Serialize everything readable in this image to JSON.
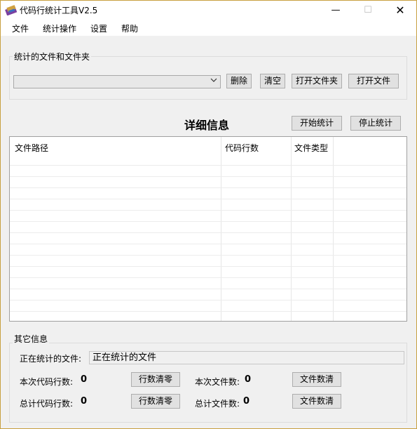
{
  "window": {
    "title": "代码行统计工具V2.5",
    "min": "—",
    "max": "☐",
    "close": "✕"
  },
  "menu": {
    "items": [
      "文件",
      "统计操作",
      "设置",
      "帮助"
    ]
  },
  "files_group": {
    "title": "统计的文件和文件夹",
    "combo_value": "",
    "buttons": {
      "delete": "删除",
      "clear": "清空",
      "open_folder": "打开文件夹",
      "open_file": "打开文件"
    }
  },
  "detail": {
    "title": "详细信息",
    "start": "开始统计",
    "stop": "停止统计",
    "columns": [
      "文件路径",
      "代码行数",
      "文件类型"
    ]
  },
  "other_group": {
    "title": "其它信息",
    "current_file_label": "正在统计的文件:",
    "current_file_value": "正在统计的文件",
    "this_lines_label": "本次代码行数:",
    "this_lines_value": "0",
    "reset_lines_1": "行数清零",
    "this_files_label": "本次文件数:",
    "this_files_value": "0",
    "reset_files_1": "文件数清",
    "total_lines_label": "总计代码行数:",
    "total_lines_value": "0",
    "reset_lines_2": "行数清零",
    "total_files_label": "总计文件数:",
    "total_files_value": "0",
    "reset_files_2": "文件数清"
  },
  "icons": {
    "app": "app-icon",
    "dropdown": "chevron-down-icon"
  }
}
